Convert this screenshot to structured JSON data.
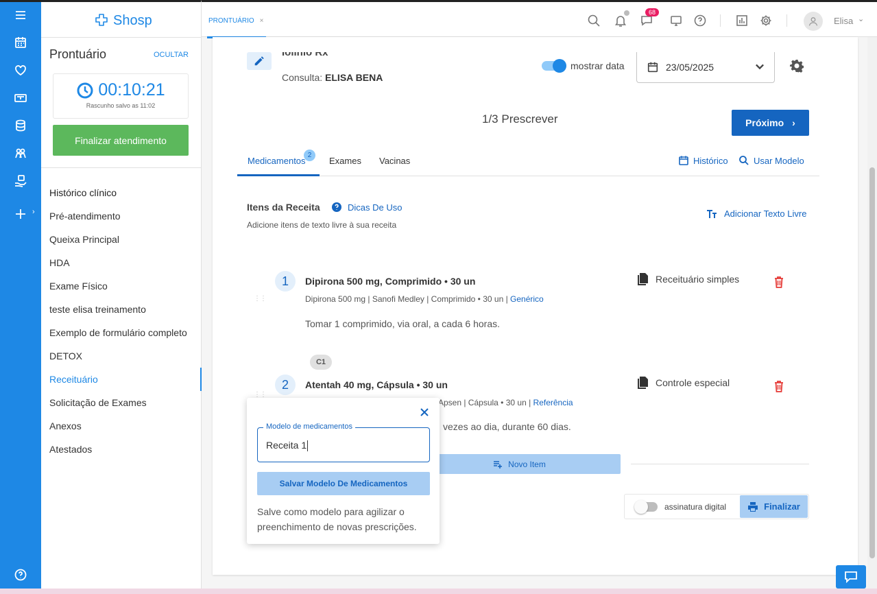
{
  "app": {
    "logo_text": "Shosp",
    "brand_color": "#1e88e5"
  },
  "rail": {
    "icons": [
      "menu-icon",
      "calendar-icon",
      "heart-icon",
      "money-icon",
      "database-icon",
      "people-icon",
      "hand-icon",
      "plus-icon",
      "help-icon"
    ]
  },
  "sidebar": {
    "title": "Prontuário",
    "hide_label": "OCULTAR",
    "timer": "00:10:21",
    "draft_status": "Rascunho salvo as 11:02",
    "finish_button": "Finalizar atendimento",
    "items": [
      {
        "label": "Histórico clínico"
      },
      {
        "label": "Pré-atendimento"
      },
      {
        "label": "Queixa Principal"
      },
      {
        "label": "HDA"
      },
      {
        "label": "Exame Físico"
      },
      {
        "label": "teste elisa treinamento"
      },
      {
        "label": "Exemplo de formulário completo"
      },
      {
        "label": "DETOX"
      },
      {
        "label": "Receituário"
      },
      {
        "label": "Solicitação de Exames"
      },
      {
        "label": "Anexos"
      },
      {
        "label": "Atestados"
      }
    ],
    "active_item": "Receituário"
  },
  "topbar": {
    "tab_label": "PRONTUÁRIO",
    "tab_close": "×",
    "messages_badge": "68",
    "user_name": "Elisa"
  },
  "header": {
    "title_cut": "Iolinio Rx",
    "consulta_label": "Consulta:",
    "consulta_name": "ELISA BENA",
    "show_date_label": "mostrar data",
    "show_date_on": true,
    "date": "23/05/2025"
  },
  "wizard": {
    "step_text": "1/3 Prescrever",
    "next_button": "Próximo"
  },
  "tabs": {
    "items": [
      {
        "label": "Medicamentos"
      },
      {
        "label": "Exames"
      },
      {
        "label": "Vacinas"
      }
    ],
    "medicamentos_badge": "2",
    "historico": "Histórico",
    "usar_modelo": "Usar Modelo"
  },
  "receita": {
    "title": "Itens da Receita",
    "tips": "Dicas De Uso",
    "subtitle": "Adicione itens de texto livre à sua receita",
    "add_free_text": "Adicionar Texto Livre",
    "items": [
      {
        "number": "1",
        "title": "Dipirona 500 mg, Comprimido • 30 un",
        "desc": "Dipirona 500 mg | Sanofi Medley | Comprimido • 30 un | ",
        "desc_link": "Genérico",
        "instructions": "Tomar 1 comprimido, via oral, a cada 6 horas.",
        "rx_type": "Receituário simples"
      },
      {
        "number": "2",
        "tag": "C1",
        "title": "Atentah 40 mg, Cápsula • 30 un",
        "desc": "Apsen | Cápsula • 30 un | ",
        "desc_link": "Referência",
        "instructions": "vezes ao dia, durante 60 dias.",
        "rx_type": "Controle especial"
      }
    ],
    "new_item": "Novo Item",
    "digital_signature": "assinatura digital",
    "digital_signature_on": false,
    "finish": "Finalizar"
  },
  "popup": {
    "field_label": "Modelo de medicamentos",
    "field_value": "Receita 1",
    "save_button": "Salvar Modelo De Medicamentos",
    "help_text": "Salve como modelo para agilizar o preenchimento de novas prescrições."
  }
}
